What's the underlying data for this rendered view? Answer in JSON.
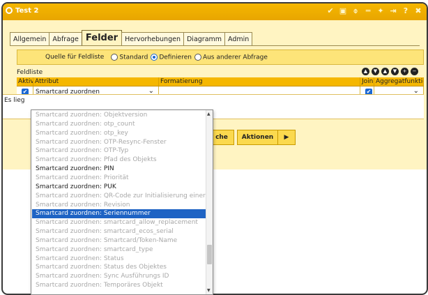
{
  "window": {
    "title": "Test 2",
    "tool_icons": [
      "check-icon",
      "square-icon",
      "link-icon",
      "minimize-icon",
      "pin-icon",
      "unpin-icon",
      "help-icon",
      "close-icon"
    ],
    "tool_glyphs": [
      "✔",
      "▣",
      "⌽",
      "═",
      "✦",
      "⇥",
      "?",
      "✖"
    ]
  },
  "tabs": [
    "Allgemein",
    "Abfrage",
    "Felder",
    "Hervorhebungen",
    "Diagramm",
    "Admin"
  ],
  "active_tab": "Felder",
  "quelle": {
    "label": "Quelle für Feldliste",
    "options": [
      "Standard",
      "Definieren",
      "Aus anderer Abfrage"
    ],
    "selected": "Definieren"
  },
  "feldliste": {
    "label": "Feldliste",
    "tool_glyphs": [
      "▲",
      "▼",
      "▲",
      "▼",
      "+",
      "−"
    ]
  },
  "grid": {
    "headers": {
      "aktiv": "Aktiv",
      "attribut": "Attribut",
      "formatierung": "Formatierung",
      "join": "Join",
      "aggregat": "Aggregatfunktion"
    },
    "rows": [
      {
        "aktiv": true,
        "attribut": "Smartcard zuordnen",
        "formatierung": "",
        "join": true,
        "aggregat": ""
      },
      {
        "aktiv": false,
        "attribut": "---",
        "formatierung": "",
        "join": false,
        "aggregat": ""
      }
    ]
  },
  "status": {
    "message": "Es lieg"
  },
  "buttons": {
    "suche": "che",
    "aktionen": "Aktionen",
    "aktionen_arrow": "▶"
  },
  "dropdown": {
    "items": [
      {
        "label": "Smartcard zuordnen: Objektversion",
        "enabled": false
      },
      {
        "label": "Smartcard zuordnen: otp_count",
        "enabled": false
      },
      {
        "label": "Smartcard zuordnen: otp_key",
        "enabled": false
      },
      {
        "label": "Smartcard zuordnen: OTP-Resync-Fenster",
        "enabled": false
      },
      {
        "label": "Smartcard zuordnen: OTP-Typ",
        "enabled": false
      },
      {
        "label": "Smartcard zuordnen: Pfad des Objekts",
        "enabled": false
      },
      {
        "label": "Smartcard zuordnen: PIN",
        "enabled": true
      },
      {
        "label": "Smartcard zuordnen: Priorität",
        "enabled": false
      },
      {
        "label": "Smartcard zuordnen: PUK",
        "enabled": true
      },
      {
        "label": "Smartcard zuordnen: QR-Code zur Initialisierung einer App",
        "enabled": false
      },
      {
        "label": "Smartcard zuordnen: Revision",
        "enabled": false
      },
      {
        "label": "Smartcard zuordnen: Seriennummer",
        "enabled": true,
        "selected": true
      },
      {
        "label": "Smartcard zuordnen: smartcard_allow_replacement",
        "enabled": false
      },
      {
        "label": "Smartcard zuordnen: smartcard_ecos_serial",
        "enabled": false
      },
      {
        "label": "Smartcard zuordnen: Smartcard/Token-Name",
        "enabled": false
      },
      {
        "label": "Smartcard zuordnen: smartcard_type",
        "enabled": false
      },
      {
        "label": "Smartcard zuordnen: Status",
        "enabled": false
      },
      {
        "label": "Smartcard zuordnen: Status des Objektes",
        "enabled": false
      },
      {
        "label": "Smartcard zuordnen: Sync Ausführungs ID",
        "enabled": false
      },
      {
        "label": "Smartcard zuordnen: Temporäres Objekt",
        "enabled": false
      }
    ]
  },
  "colors": {
    "accent": "#f5b700",
    "pane": "#fff4c2",
    "selection": "#1e63c4"
  }
}
